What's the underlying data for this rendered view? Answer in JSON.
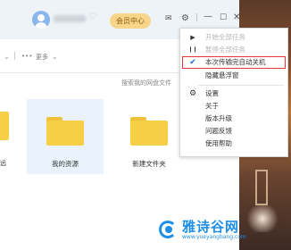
{
  "header": {
    "vip_button": "会员中心"
  },
  "toolbar": {
    "more_label": "更多"
  },
  "search": {
    "placeholder": "搜索我的网盘文件"
  },
  "files": [
    {
      "name": "我的资源"
    },
    {
      "name": "新建文件夹"
    }
  ],
  "left_peek": "远",
  "menu": {
    "items": [
      {
        "label": "开始全部任务",
        "icon": "play-icon",
        "disabled": true
      },
      {
        "label": "暂停全部任务",
        "icon": "pause-icon",
        "disabled": true
      },
      {
        "label": "本次传输完自动关机",
        "icon": "checkmark-icon",
        "checked": true
      },
      {
        "label": "隐藏悬浮窗"
      },
      {
        "label": "设置",
        "icon": "gear-icon"
      },
      {
        "label": "关于"
      },
      {
        "label": "版本升级"
      },
      {
        "label": "问题反馈"
      },
      {
        "label": "使用帮助"
      }
    ]
  },
  "watermark": {
    "title": "雅诗谷网",
    "url": "www.yueyangbang.com"
  },
  "colors": {
    "accent": "#1e8fe6",
    "highlight_border": "#e53935",
    "folder": "#f7cf47",
    "vip_bg": "#f7d58a"
  }
}
